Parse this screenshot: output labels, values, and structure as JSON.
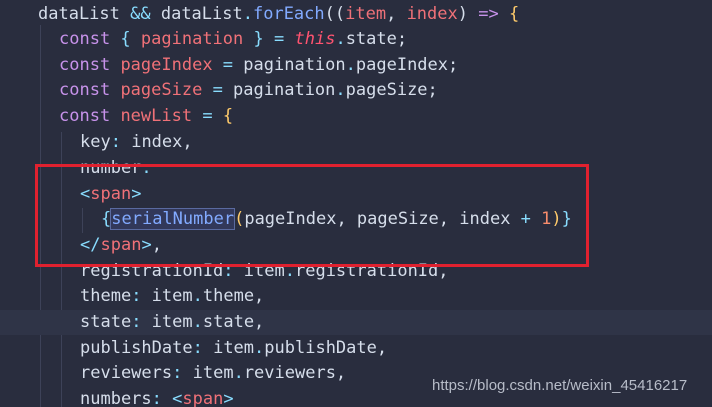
{
  "editor": {
    "lines": [
      {
        "tokens": [
          {
            "t": "dataList",
            "c": "plain"
          },
          {
            "t": " && ",
            "c": "op"
          },
          {
            "t": "dataList",
            "c": "plain"
          },
          {
            "t": ".",
            "c": "op"
          },
          {
            "t": "forEach",
            "c": "fn"
          },
          {
            "t": "((",
            "c": "plain"
          },
          {
            "t": "item",
            "c": "var"
          },
          {
            "t": ", ",
            "c": "plain"
          },
          {
            "t": "index",
            "c": "var"
          },
          {
            "t": ") ",
            "c": "plain"
          },
          {
            "t": "=>",
            "c": "kw"
          },
          {
            "t": " {",
            "c": "brace"
          }
        ]
      },
      {
        "tokens": [
          {
            "t": "const",
            "c": "kw"
          },
          {
            "t": " { ",
            "c": "op"
          },
          {
            "t": "pagination",
            "c": "var"
          },
          {
            "t": " } ",
            "c": "op"
          },
          {
            "t": "=",
            "c": "op"
          },
          {
            "t": " ",
            "c": "plain"
          },
          {
            "t": "this",
            "c": "this"
          },
          {
            "t": ".",
            "c": "op"
          },
          {
            "t": "state;",
            "c": "plain"
          }
        ]
      },
      {
        "tokens": [
          {
            "t": "const",
            "c": "kw"
          },
          {
            "t": " ",
            "c": "plain"
          },
          {
            "t": "pageIndex",
            "c": "var"
          },
          {
            "t": " = ",
            "c": "op"
          },
          {
            "t": "pagination",
            "c": "plain"
          },
          {
            "t": ".",
            "c": "op"
          },
          {
            "t": "pageIndex;",
            "c": "plain"
          }
        ]
      },
      {
        "tokens": [
          {
            "t": "const",
            "c": "kw"
          },
          {
            "t": " ",
            "c": "plain"
          },
          {
            "t": "pageSize",
            "c": "var"
          },
          {
            "t": " = ",
            "c": "op"
          },
          {
            "t": "pagination",
            "c": "plain"
          },
          {
            "t": ".",
            "c": "op"
          },
          {
            "t": "pageSize;",
            "c": "plain"
          }
        ]
      },
      {
        "tokens": [
          {
            "t": "const",
            "c": "kw"
          },
          {
            "t": " ",
            "c": "plain"
          },
          {
            "t": "newList",
            "c": "var"
          },
          {
            "t": " = ",
            "c": "op"
          },
          {
            "t": "{",
            "c": "brace"
          }
        ]
      },
      {
        "tokens": [
          {
            "t": "key",
            "c": "plain"
          },
          {
            "t": ": ",
            "c": "op"
          },
          {
            "t": "index,",
            "c": "plain"
          }
        ]
      },
      {
        "tokens": [
          {
            "t": "number",
            "c": "plain"
          },
          {
            "t": ":",
            "c": "op"
          }
        ]
      },
      {
        "tokens": [
          {
            "t": "<",
            "c": "punct"
          },
          {
            "t": "span",
            "c": "tag"
          },
          {
            "t": ">",
            "c": "punct"
          }
        ]
      },
      {
        "tokens": [
          {
            "t": "{",
            "c": "punct"
          },
          {
            "t": "serialNumber",
            "c": "fn",
            "hl": true
          },
          {
            "t": "(",
            "c": "brace"
          },
          {
            "t": "pageIndex, pageSize, index ",
            "c": "plain"
          },
          {
            "t": "+",
            "c": "op"
          },
          {
            "t": " ",
            "c": "plain"
          },
          {
            "t": "1",
            "c": "num"
          },
          {
            "t": ")",
            "c": "brace"
          },
          {
            "t": "}",
            "c": "punct"
          }
        ]
      },
      {
        "tokens": [
          {
            "t": "</",
            "c": "punct"
          },
          {
            "t": "span",
            "c": "tag"
          },
          {
            "t": ">",
            "c": "punct"
          },
          {
            "t": ",",
            "c": "plain"
          }
        ]
      },
      {
        "tokens": [
          {
            "t": "registrationId",
            "c": "plain"
          },
          {
            "t": ": ",
            "c": "op"
          },
          {
            "t": "item",
            "c": "plain"
          },
          {
            "t": ".",
            "c": "op"
          },
          {
            "t": "registrationId,",
            "c": "plain"
          }
        ]
      },
      {
        "tokens": [
          {
            "t": "theme",
            "c": "plain"
          },
          {
            "t": ": ",
            "c": "op"
          },
          {
            "t": "item",
            "c": "plain"
          },
          {
            "t": ".",
            "c": "op"
          },
          {
            "t": "theme,",
            "c": "plain"
          }
        ]
      },
      {
        "tokens": [
          {
            "t": "state",
            "c": "plain"
          },
          {
            "t": ": ",
            "c": "op"
          },
          {
            "t": "item",
            "c": "plain"
          },
          {
            "t": ".",
            "c": "op"
          },
          {
            "t": "state,",
            "c": "plain"
          }
        ]
      },
      {
        "tokens": [
          {
            "t": "publishDate",
            "c": "plain"
          },
          {
            "t": ": ",
            "c": "op"
          },
          {
            "t": "item",
            "c": "plain"
          },
          {
            "t": ".",
            "c": "op"
          },
          {
            "t": "publishDate,",
            "c": "plain"
          }
        ]
      },
      {
        "tokens": [
          {
            "t": "reviewers",
            "c": "plain"
          },
          {
            "t": ": ",
            "c": "op"
          },
          {
            "t": "item",
            "c": "plain"
          },
          {
            "t": ".",
            "c": "op"
          },
          {
            "t": "reviewers,",
            "c": "plain"
          }
        ]
      },
      {
        "tokens": [
          {
            "t": "numbers",
            "c": "plain"
          },
          {
            "t": ": ",
            "c": "op"
          },
          {
            "t": "<",
            "c": "punct"
          },
          {
            "t": "span",
            "c": "tag"
          },
          {
            "t": ">",
            "c": "punct"
          }
        ]
      }
    ]
  },
  "watermark": "https://blog.csdn.net/weixin_45416217"
}
